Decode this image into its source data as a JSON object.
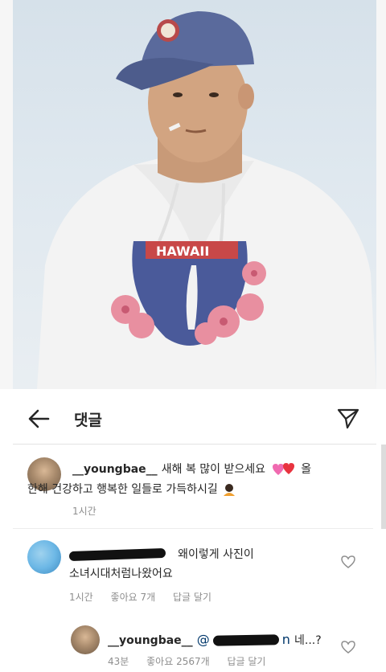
{
  "header": {
    "title": "댓글"
  },
  "caption": {
    "username": "__youngbae__",
    "text_line1": "새해 복 많이 받으세요",
    "text_line1_tail": "올",
    "text_line2": "한해 건강하고 행복한 일들로 가득하시길",
    "time": "1시간"
  },
  "comments": [
    {
      "username": "",
      "text_line1": "왜이렇게 사진이",
      "text_line2": "소녀시대처럼나왔어요",
      "time": "1시간",
      "likes": "좋아요 7개",
      "reply": "답글 달기"
    }
  ],
  "reply": {
    "username": "__youngbae__",
    "mention_visible": "@",
    "mention_tail": "n",
    "text": "네...?",
    "time": "43분",
    "likes": "좋아요 2567개",
    "reply_label": "답글 달기"
  },
  "icons": {
    "back": "arrow-left-icon",
    "send": "paper-plane-icon",
    "like": "heart-outline-icon"
  },
  "colors": {
    "text": "#262626",
    "secondary": "#8e8e8e",
    "mention": "#00376b",
    "sky": "#d6e1ea",
    "hoodie": "#f3f3f3",
    "cap": "#5a6a9c"
  }
}
